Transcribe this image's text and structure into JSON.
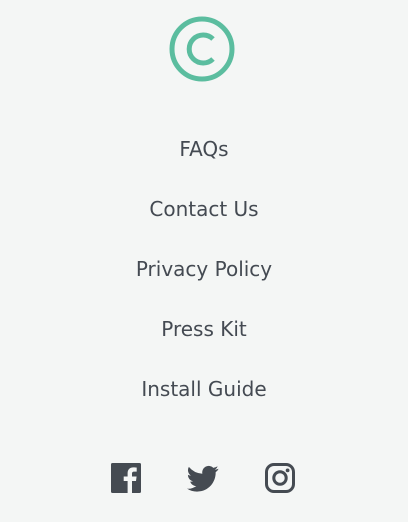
{
  "colors": {
    "background": "#f4f6f5",
    "accent": "#5bbd9f",
    "link": "#444a52",
    "icon": "#454b52"
  },
  "logo": {
    "icon": "copyright-icon"
  },
  "nav": {
    "links": [
      {
        "label": "FAQs"
      },
      {
        "label": "Contact Us"
      },
      {
        "label": "Privacy Policy"
      },
      {
        "label": "Press Kit"
      },
      {
        "label": "Install Guide"
      }
    ]
  },
  "social": {
    "icons": [
      "facebook-icon",
      "twitter-icon",
      "instagram-icon"
    ]
  }
}
